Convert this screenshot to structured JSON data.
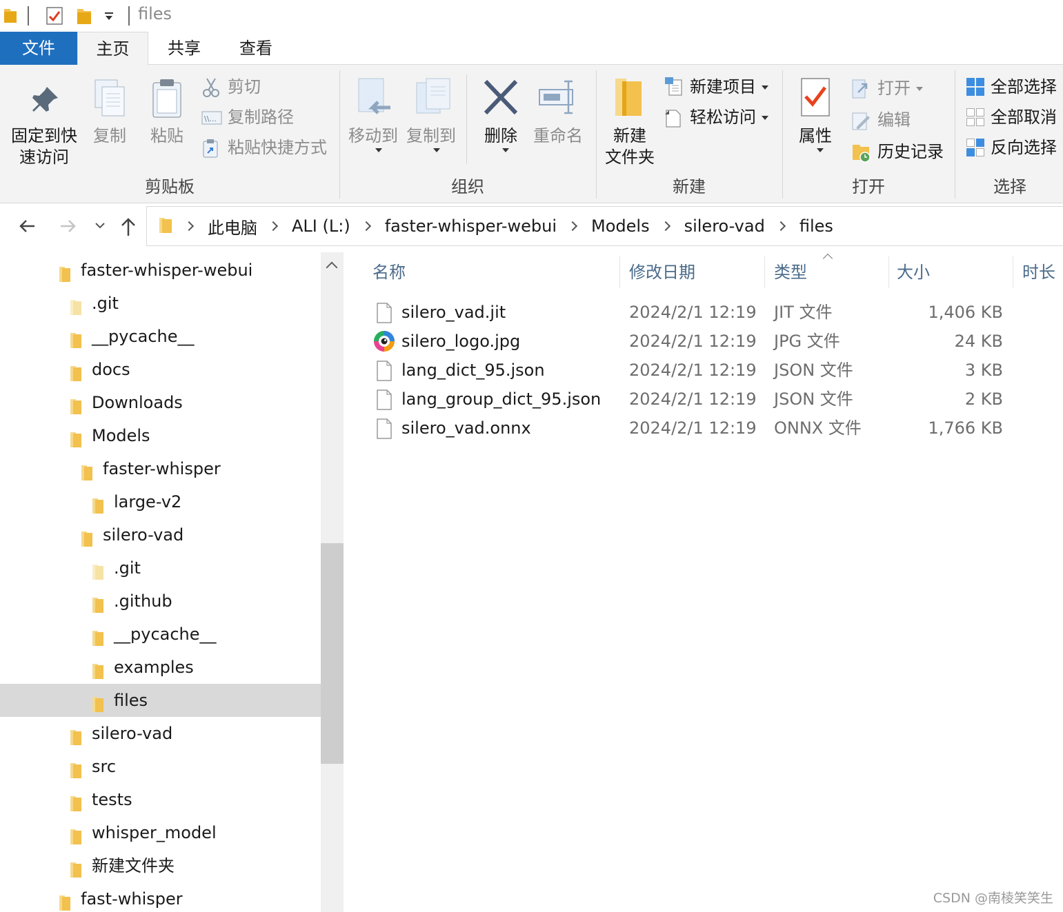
{
  "window": {
    "title": "files"
  },
  "tabs": [
    {
      "label": "文件"
    },
    {
      "label": "主页"
    },
    {
      "label": "共享"
    },
    {
      "label": "查看"
    }
  ],
  "ribbon": {
    "clipboard": {
      "pin_line1": "固定到快",
      "pin_line2": "速访问",
      "copy": "复制",
      "paste": "粘贴",
      "cut": "剪切",
      "copy_path": "复制路径",
      "paste_shortcut": "粘贴快捷方式",
      "group": "剪贴板"
    },
    "organize": {
      "move_to": "移动到",
      "copy_to": "复制到",
      "delete": "删除",
      "rename": "重命名",
      "group": "组织"
    },
    "new": {
      "new_folder_line1": "新建",
      "new_folder_line2": "文件夹",
      "new_item": "新建项目",
      "easy_access": "轻松访问",
      "group": "新建"
    },
    "open": {
      "properties": "属性",
      "open": "打开",
      "edit": "编辑",
      "history": "历史记录",
      "group": "打开"
    },
    "select": {
      "select_all": "全部选择",
      "select_none": "全部取消",
      "invert": "反向选择",
      "group": "选择"
    }
  },
  "breadcrumb": [
    "此电脑",
    "ALI (L:)",
    "faster-whisper-webui",
    "Models",
    "silero-vad",
    "files"
  ],
  "tree": [
    {
      "label": "faster-whisper-webui",
      "depth": 0
    },
    {
      "label": ".git",
      "depth": 1,
      "faded": true
    },
    {
      "label": "__pycache__",
      "depth": 1
    },
    {
      "label": "docs",
      "depth": 1
    },
    {
      "label": "Downloads",
      "depth": 1
    },
    {
      "label": "Models",
      "depth": 1
    },
    {
      "label": "faster-whisper",
      "depth": 2
    },
    {
      "label": "large-v2",
      "depth": 3
    },
    {
      "label": "silero-vad",
      "depth": 2
    },
    {
      "label": ".git",
      "depth": 3,
      "faded": true
    },
    {
      "label": ".github",
      "depth": 3
    },
    {
      "label": "__pycache__",
      "depth": 3
    },
    {
      "label": "examples",
      "depth": 3
    },
    {
      "label": "files",
      "depth": 3,
      "selected": true
    },
    {
      "label": "silero-vad",
      "depth": 1
    },
    {
      "label": "src",
      "depth": 1
    },
    {
      "label": "tests",
      "depth": 1
    },
    {
      "label": "whisper_model",
      "depth": 1
    },
    {
      "label": "新建文件夹",
      "depth": 1
    },
    {
      "label": "fast-whisper",
      "depth": 0
    }
  ],
  "columns": {
    "name": "名称",
    "date": "修改日期",
    "type": "类型",
    "size": "大小",
    "duration": "时长"
  },
  "files": [
    {
      "name": "silero_vad.jit",
      "date": "2024/2/1 12:19",
      "type": "JIT 文件",
      "size": "1,406 KB",
      "icon": "blank-file-icon"
    },
    {
      "name": "silero_logo.jpg",
      "date": "2024/2/1 12:19",
      "type": "JPG 文件",
      "size": "24 KB",
      "icon": "image-viewer-icon"
    },
    {
      "name": "lang_dict_95.json",
      "date": "2024/2/1 12:19",
      "type": "JSON 文件",
      "size": "3 KB",
      "icon": "blank-file-icon"
    },
    {
      "name": "lang_group_dict_95.json",
      "date": "2024/2/1 12:19",
      "type": "JSON 文件",
      "size": "2 KB",
      "icon": "blank-file-icon"
    },
    {
      "name": "silero_vad.onnx",
      "date": "2024/2/1 12:19",
      "type": "ONNX 文件",
      "size": "1,766 KB",
      "icon": "blank-file-icon"
    }
  ],
  "watermark": "CSDN @南棱笑笑生",
  "colors": {
    "accent": "#1f6fbf",
    "folder": "#f2c14e",
    "selection": "#d9d9d9"
  }
}
